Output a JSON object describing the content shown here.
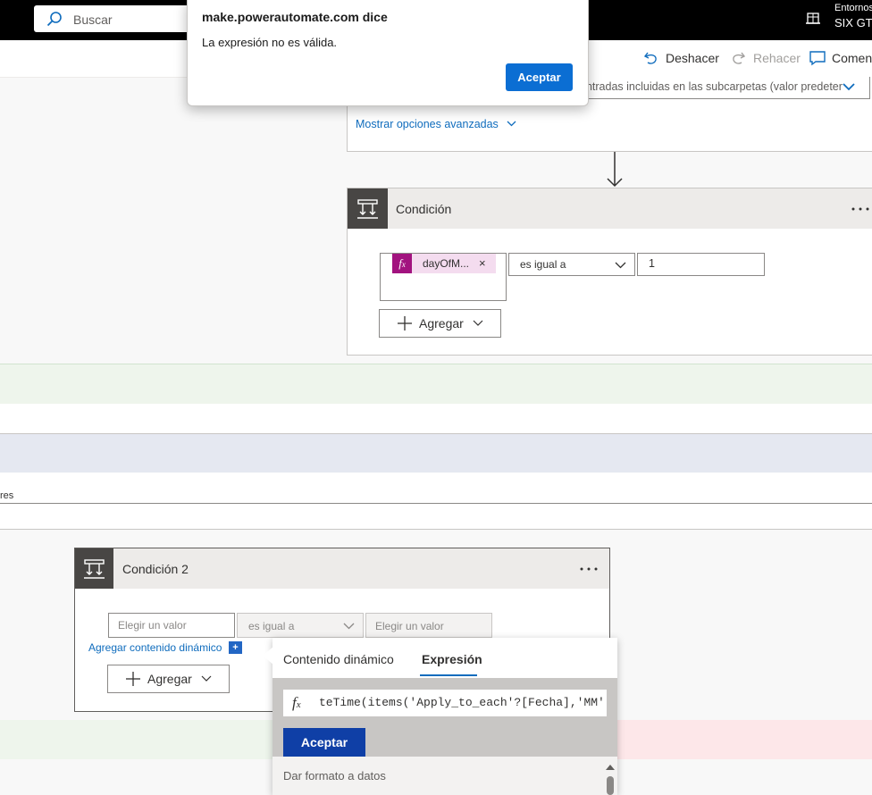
{
  "header": {
    "search_placeholder": "Buscar",
    "environments_label": "Entornos",
    "environment_name": "SIX GTS"
  },
  "command_bar": {
    "undo": "Deshacer",
    "redo": "Rehacer",
    "comments": "Comen"
  },
  "dialog": {
    "title": "make.powerautomate.com dice",
    "message": "La expresión no es válida.",
    "ok": "Aceptar"
  },
  "previous_action": {
    "folder_option_text": "entradas incluidas en las subcarpetas (valor predeter",
    "show_advanced": "Mostrar opciones avanzadas"
  },
  "condition1": {
    "title": "Condición",
    "token_label": "dayOfM...",
    "operator": "es igual a",
    "value": "1",
    "add_label": "Agregar"
  },
  "left_clip_text": "res",
  "condition2": {
    "title": "Condición 2",
    "left_placeholder": "Elegir un valor",
    "operator": "es igual a",
    "right_placeholder": "Elegir un valor",
    "dynamic_content_link": "Agregar contenido dinámico",
    "add_label": "Agregar"
  },
  "expression_panel": {
    "tabs": [
      "Contenido dinámico",
      "Expresión"
    ],
    "active_tab": "Expresión",
    "expression_text": "teTime(items('Apply_to_each'?[Fecha],'MM')",
    "ok_label": "Aceptar",
    "section_label": "Dar formato a datos"
  },
  "colors": {
    "accent": "#0f6cbd",
    "expression_token": "#a2137f",
    "dialog_button": "#0b6ed3"
  }
}
